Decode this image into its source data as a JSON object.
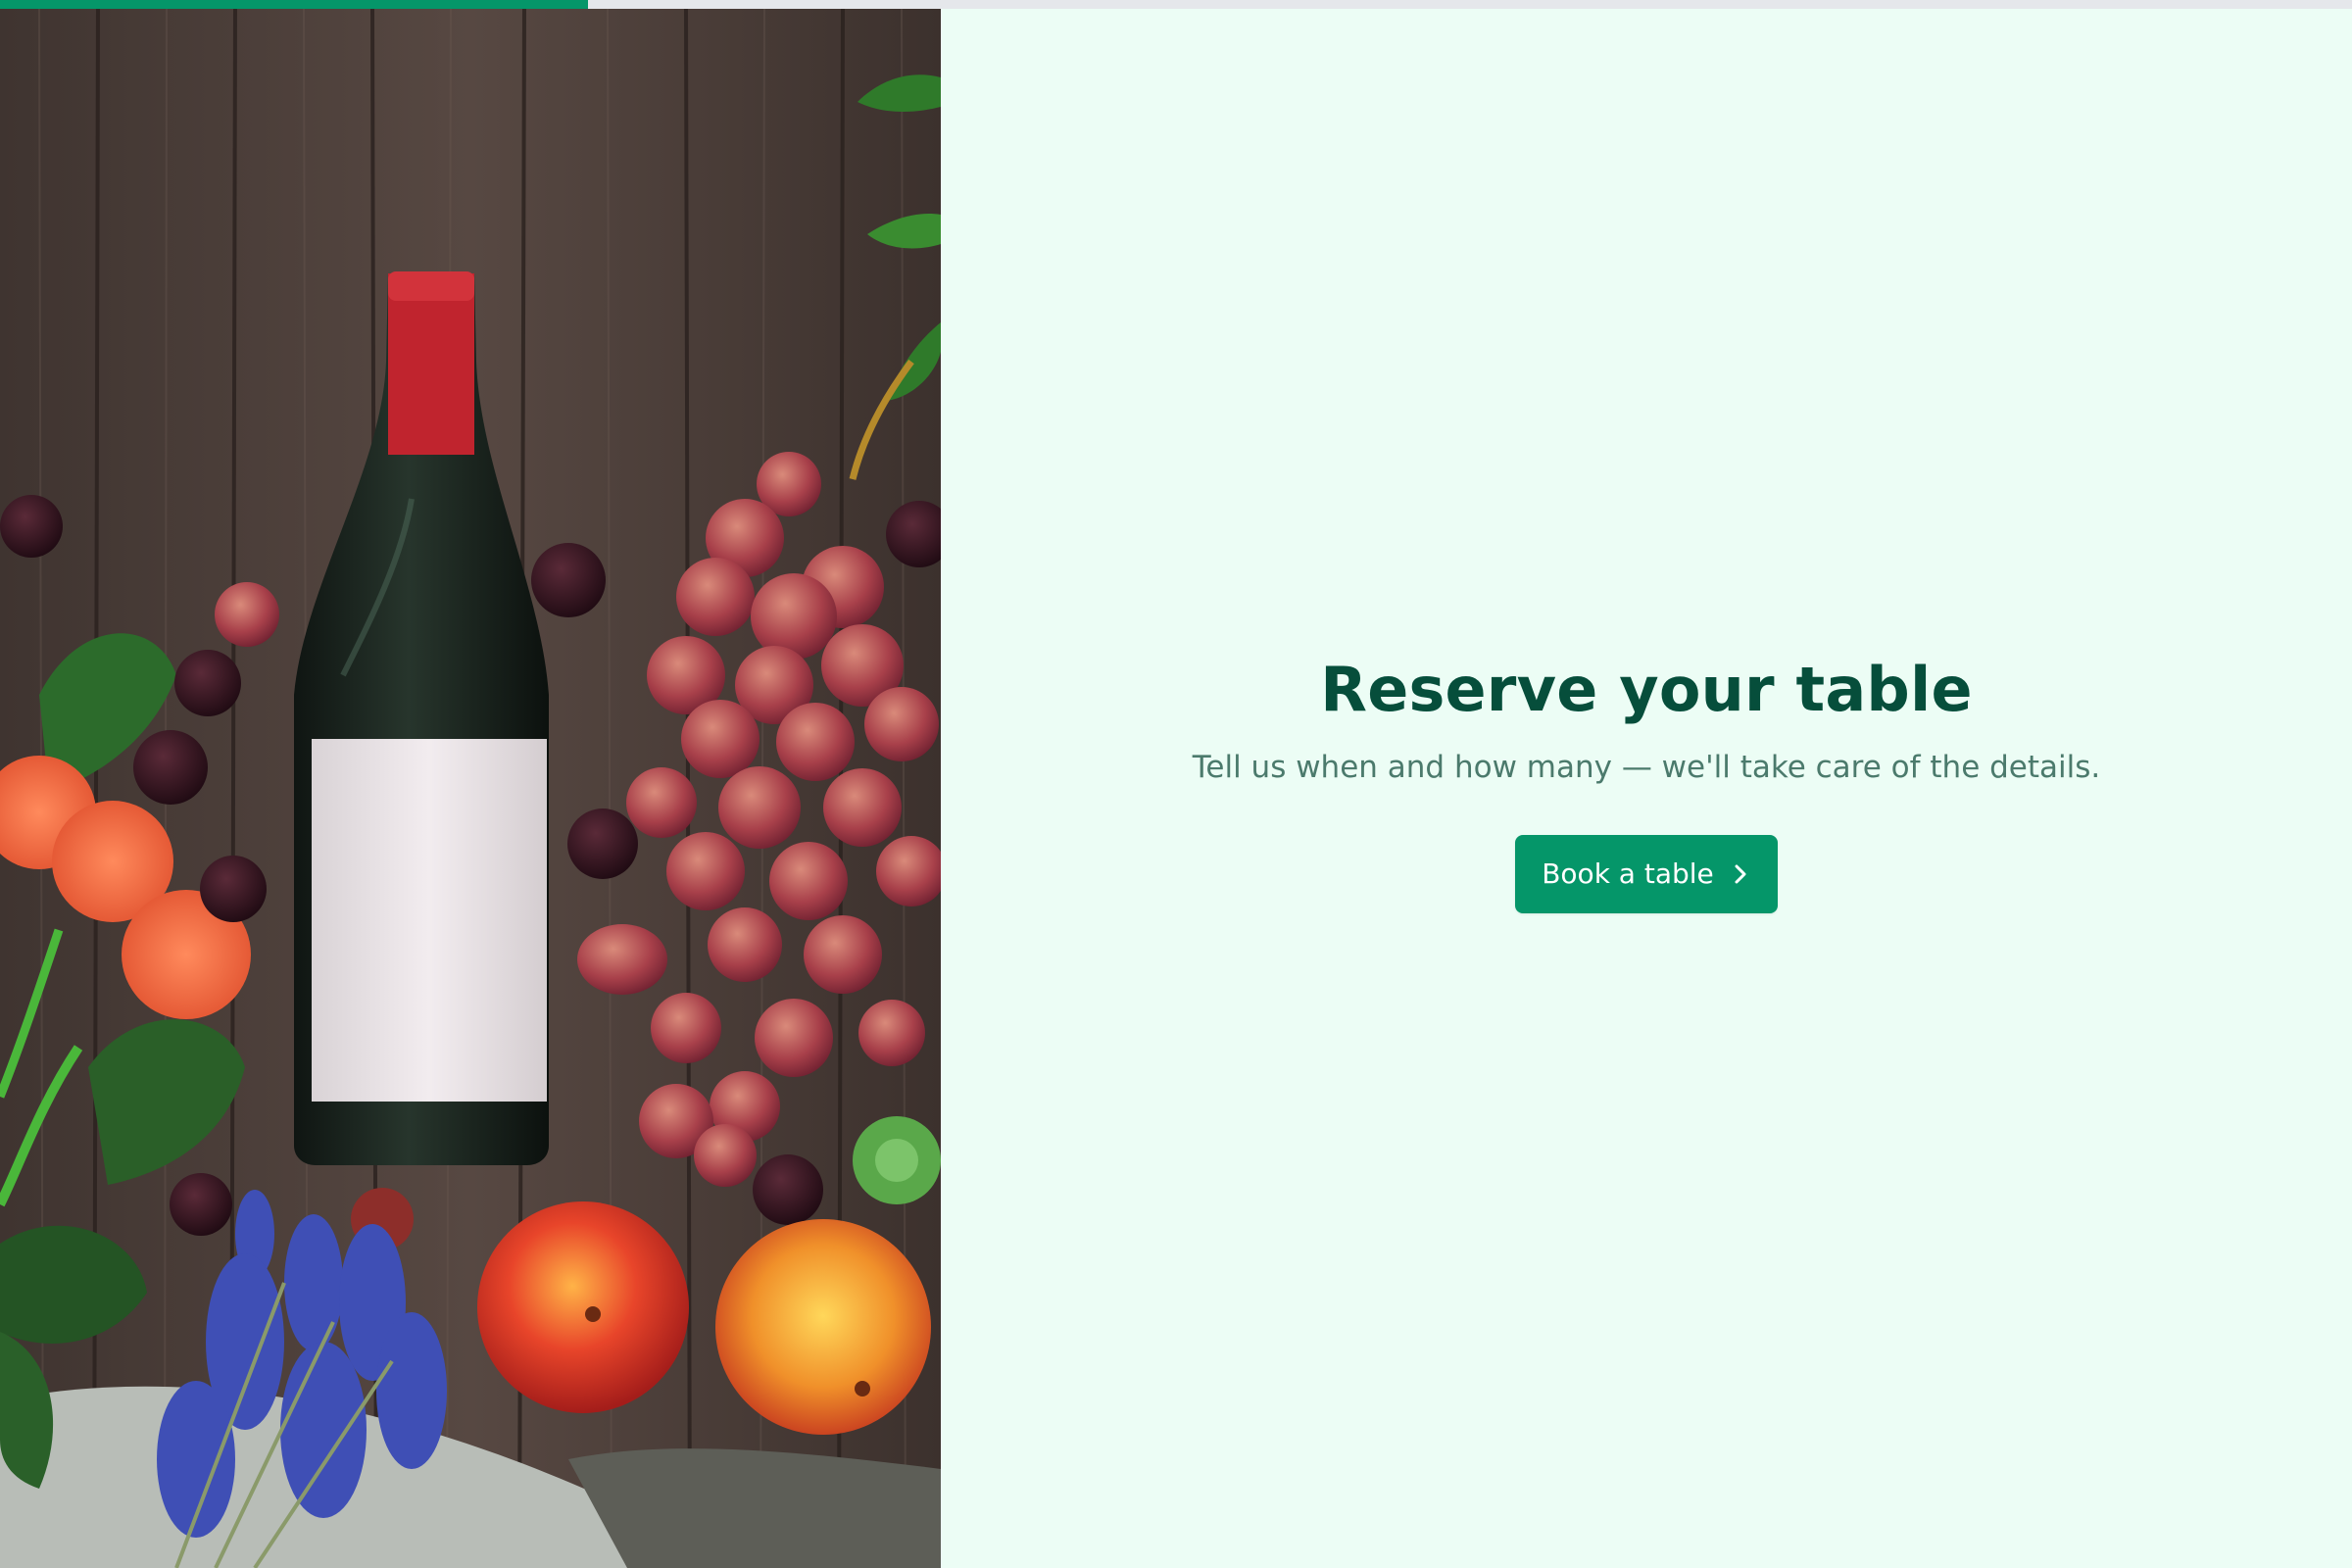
{
  "progress": {
    "fraction": 0.25,
    "fill_color": "#059669",
    "track_color": "#e5e7eb"
  },
  "hero": {
    "image": "wine-bottle-grapes-flatlay",
    "icon": "wine-bottle-photo"
  },
  "main": {
    "title": "Reserve your table",
    "subtitle": "Tell us when and how many — we'll take care of the details.",
    "cta_label": "Book a table",
    "cta_icon": "chevron-right-icon"
  },
  "colors": {
    "background": "#ecfdf5",
    "title": "#064e3b",
    "subtitle": "#4b7a6c",
    "accent": "#059669"
  }
}
